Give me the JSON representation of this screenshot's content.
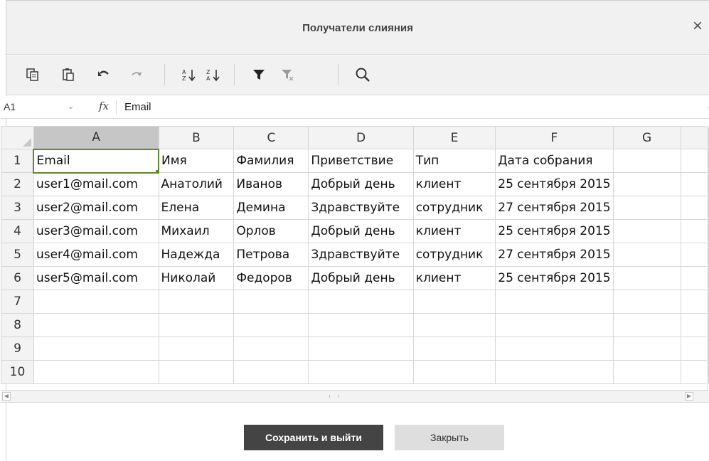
{
  "dialog": {
    "title": "Получатели слияния",
    "close_glyph": "×"
  },
  "toolbar": {
    "icons": [
      "copy-icon",
      "paste-icon",
      "undo-icon",
      "redo-icon",
      "sort-ascending-icon",
      "sort-descending-icon",
      "filter-icon",
      "clear-filter-icon",
      "search-icon"
    ]
  },
  "formula_bar": {
    "cell_name": "A1",
    "fx_label": "fx",
    "value": "Email"
  },
  "sheet": {
    "columns": [
      "A",
      "B",
      "C",
      "D",
      "E",
      "F",
      "G"
    ],
    "row_numbers": [
      "1",
      "2",
      "3",
      "4",
      "5",
      "6",
      "7",
      "8",
      "9",
      "10"
    ],
    "rows": [
      [
        "Email",
        "Имя",
        "Фамилия",
        "Приветствие",
        "Тип",
        "Дата собрания",
        ""
      ],
      [
        "user1@mail.com",
        "Анатолий",
        "Иванов",
        "Добрый день",
        "клиент",
        "25 сентября 2015",
        ""
      ],
      [
        "user2@mail.com",
        "Елена",
        "Демина",
        "Здравствуйте",
        "сотрудник",
        "27 сентября 2015",
        ""
      ],
      [
        "user3@mail.com",
        "Михаил",
        "Орлов",
        "Добрый день",
        "клиент",
        "25 сентября 2015",
        ""
      ],
      [
        "user4@mail.com",
        "Надежда",
        "Петрова",
        "Здравствуйте",
        "сотрудник",
        "27 сентября 2015",
        ""
      ],
      [
        "user5@mail.com",
        "Николай",
        "Федоров",
        "Добрый день",
        "клиент",
        "25 сентября 2015",
        ""
      ],
      [
        "",
        "",
        "",
        "",
        "",
        "",
        ""
      ],
      [
        "",
        "",
        "",
        "",
        "",
        "",
        ""
      ],
      [
        "",
        "",
        "",
        "",
        "",
        "",
        ""
      ],
      [
        "",
        "",
        "",
        "",
        "",
        "",
        ""
      ]
    ],
    "active_cell": "A1"
  },
  "buttons": {
    "save_exit": "Сохранить и выйти",
    "close": "Закрыть"
  },
  "colors": {
    "primary_button": "#444444",
    "selection_border": "#5b8a2a",
    "header_bg": "#f1f1f1"
  }
}
